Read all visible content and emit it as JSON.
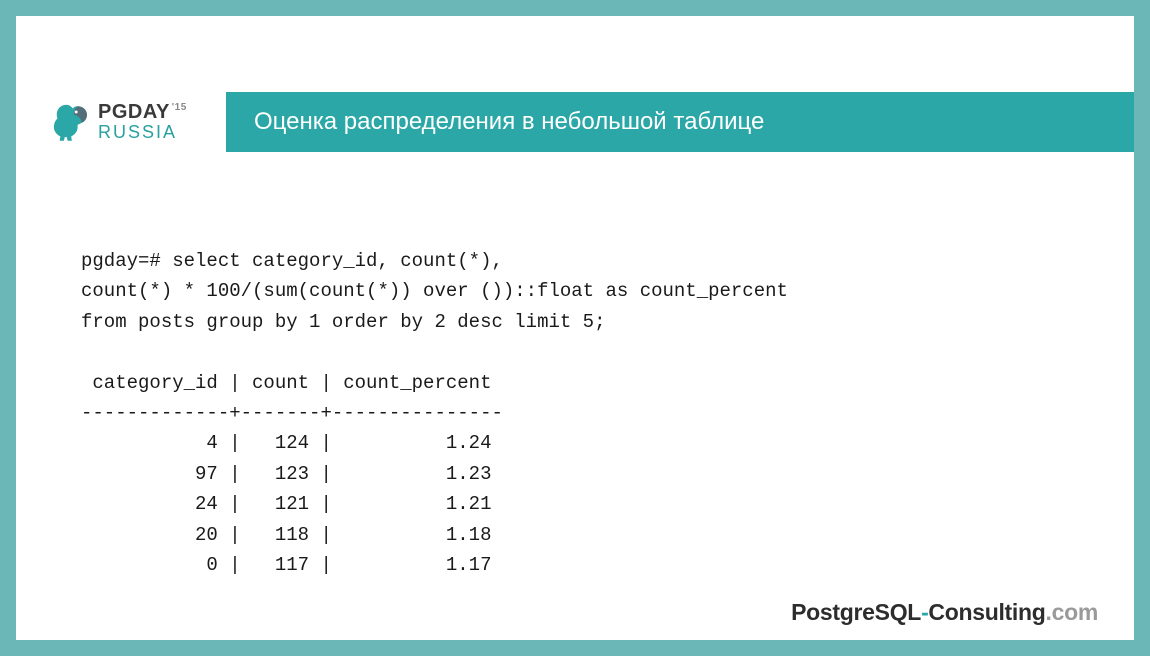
{
  "logo": {
    "top": "PGDAY",
    "year_sup": "'15",
    "bottom": "RUSSIA"
  },
  "title": "Оценка распределения в небольшой таблице",
  "sql": "pgday=# select category_id, count(*),\ncount(*) * 100/(sum(count(*)) over ())::float as count_percent\nfrom posts group by 1 order by 2 desc limit 5;\n\n category_id | count | count_percent\n-------------+-------+---------------\n           4 |   124 |          1.24\n          97 |   123 |          1.23\n          24 |   121 |          1.21\n          20 |   118 |          1.18\n           0 |   117 |          1.17",
  "footer": {
    "pg": "PostgreSQL",
    "dash": "-",
    "consulting": "Consulting",
    "tld": ".com"
  },
  "chart_data": {
    "type": "table",
    "title": "Оценка распределения в небольшой таблице",
    "columns": [
      "category_id",
      "count",
      "count_percent"
    ],
    "rows": [
      {
        "category_id": 4,
        "count": 124,
        "count_percent": 1.24
      },
      {
        "category_id": 97,
        "count": 123,
        "count_percent": 1.23
      },
      {
        "category_id": 24,
        "count": 121,
        "count_percent": 1.21
      },
      {
        "category_id": 20,
        "count": 118,
        "count_percent": 1.18
      },
      {
        "category_id": 0,
        "count": 117,
        "count_percent": 1.17
      }
    ]
  }
}
